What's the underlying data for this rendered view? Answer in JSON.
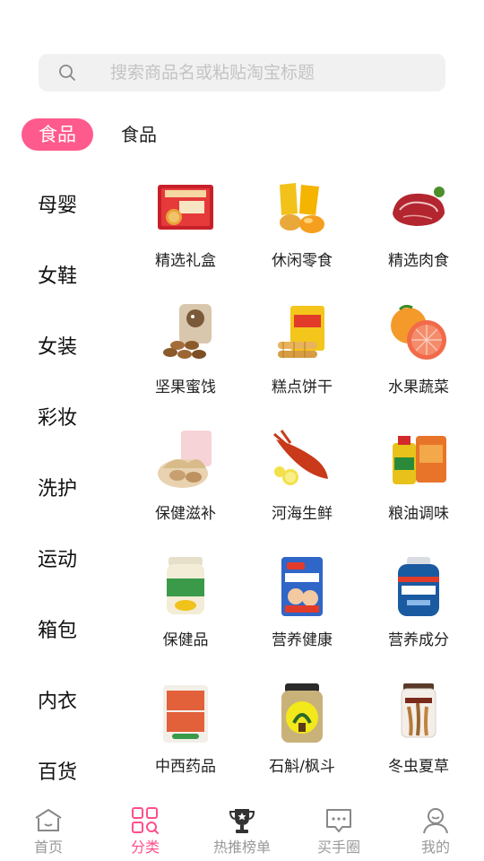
{
  "search": {
    "placeholder": "搜索商品名或粘贴淘宝标题"
  },
  "category": {
    "active_pill": "食品",
    "title": "食品"
  },
  "sidebar": {
    "items": [
      {
        "label": "母婴"
      },
      {
        "label": "女鞋"
      },
      {
        "label": "女装"
      },
      {
        "label": "彩妆"
      },
      {
        "label": "洗护"
      },
      {
        "label": "运动"
      },
      {
        "label": "箱包"
      },
      {
        "label": "内衣"
      },
      {
        "label": "百货"
      }
    ]
  },
  "grid": {
    "items": [
      {
        "label": "精选礼盒",
        "icon": "gift-box-icon"
      },
      {
        "label": "休闲零食",
        "icon": "snack-icon"
      },
      {
        "label": "精选肉食",
        "icon": "meat-icon"
      },
      {
        "label": "坚果蜜饯",
        "icon": "nuts-icon"
      },
      {
        "label": "糕点饼干",
        "icon": "biscuit-icon"
      },
      {
        "label": "水果蔬菜",
        "icon": "fruit-icon"
      },
      {
        "label": "保健滋补",
        "icon": "tonic-icon"
      },
      {
        "label": "河海生鲜",
        "icon": "seafood-icon"
      },
      {
        "label": "粮油调味",
        "icon": "grain-oil-icon"
      },
      {
        "label": "保健品",
        "icon": "supplement-jar-icon"
      },
      {
        "label": "营养健康",
        "icon": "milk-powder-icon"
      },
      {
        "label": "营养成分",
        "icon": "calcium-bottle-icon"
      },
      {
        "label": "中西药品",
        "icon": "medicine-box-icon"
      },
      {
        "label": "石斛/枫斗",
        "icon": "dendrobium-jar-icon"
      },
      {
        "label": "冬虫夏草",
        "icon": "cordyceps-icon"
      }
    ]
  },
  "tabbar": {
    "items": [
      {
        "label": "首页",
        "icon": "home-icon"
      },
      {
        "label": "分类",
        "icon": "category-icon",
        "active": true
      },
      {
        "label": "热推榜单",
        "icon": "trophy-icon"
      },
      {
        "label": "买手圈",
        "icon": "chat-icon"
      },
      {
        "label": "我的",
        "icon": "profile-icon"
      }
    ]
  },
  "colors": {
    "accent": "#ff5a8d",
    "tab_active": "#ff4f8a",
    "tab_inactive": "#999999"
  }
}
